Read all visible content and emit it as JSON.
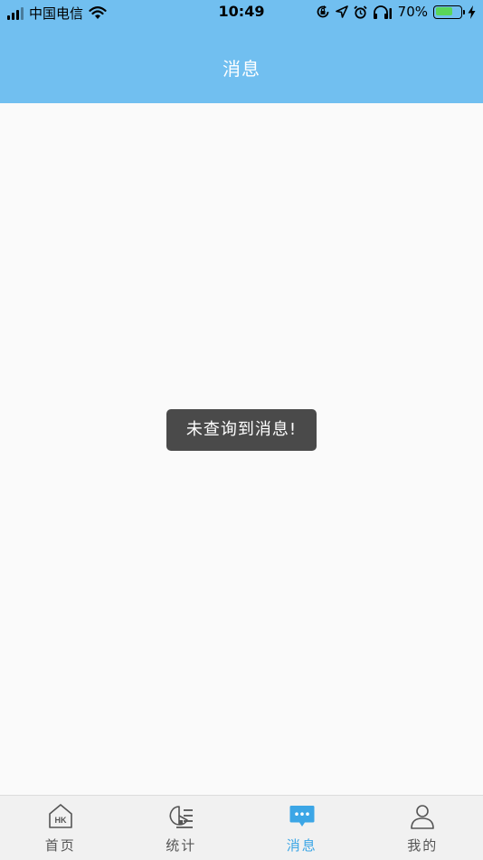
{
  "status_bar": {
    "carrier": "中国电信",
    "time": "10:49",
    "battery_percent": "70%",
    "battery_level": 0.7,
    "icons": [
      "signal-icon",
      "wifi-icon",
      "orientation-lock-icon",
      "location-icon",
      "alarm-icon",
      "headphones-icon",
      "battery-icon",
      "charging-icon"
    ]
  },
  "nav": {
    "title": "消息"
  },
  "toast": {
    "text": "未查询到消息!"
  },
  "tabbar": {
    "active_index": 2,
    "accent_color": "#3ca6e6",
    "items": [
      {
        "label": "首页",
        "icon": "home-hk-icon",
        "icon_text": "HK"
      },
      {
        "label": "统计",
        "icon": "statistics-icon"
      },
      {
        "label": "消息",
        "icon": "message-icon"
      },
      {
        "label": "我的",
        "icon": "profile-icon"
      }
    ]
  },
  "colors": {
    "header": "#71bff0",
    "background": "#fafafa",
    "toast_bg": "#4a4a4a",
    "tabbar_bg": "#f1f1f1"
  }
}
